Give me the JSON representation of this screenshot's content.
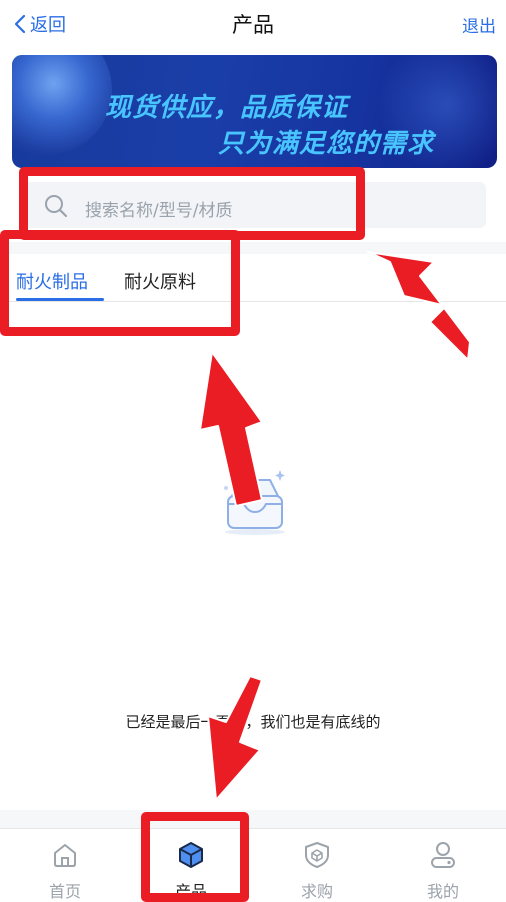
{
  "navbar": {
    "back_label": "返回",
    "title": "产品",
    "logout_label": "退出"
  },
  "banner": {
    "line1": "现货供应，品质保证",
    "line2": "只为满足您的需求"
  },
  "search": {
    "placeholder": "搜索名称/型号/材质"
  },
  "tabs": [
    {
      "label": "耐火制品",
      "active": true
    },
    {
      "label": "耐火原料",
      "active": false
    }
  ],
  "list": {
    "end_text": "已经是最后一页了，我们也是有底线的"
  },
  "tabbar": [
    {
      "label": "首页",
      "icon": "home-icon",
      "active": false
    },
    {
      "label": "产品",
      "icon": "cube-icon",
      "active": true
    },
    {
      "label": "求购",
      "icon": "shield-icon",
      "active": false
    },
    {
      "label": "我的",
      "icon": "user-icon",
      "active": false
    }
  ],
  "colors": {
    "accent": "#2a6ee6",
    "annotation": "#ea1c24",
    "banner_text": "#48c4ff"
  }
}
